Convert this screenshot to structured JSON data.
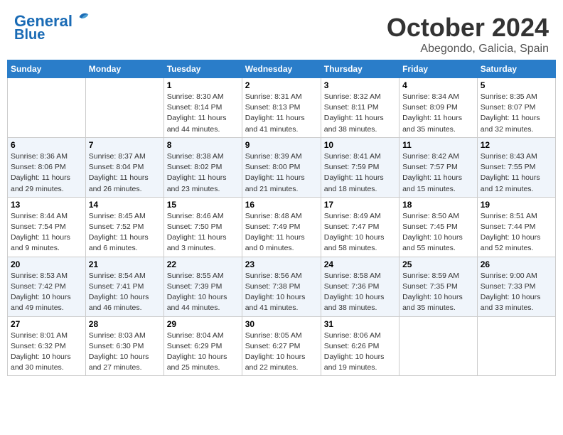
{
  "header": {
    "logo_line1": "General",
    "logo_line2": "Blue",
    "month_title": "October 2024",
    "location": "Abegondo, Galicia, Spain"
  },
  "days_of_week": [
    "Sunday",
    "Monday",
    "Tuesday",
    "Wednesday",
    "Thursday",
    "Friday",
    "Saturday"
  ],
  "weeks": [
    [
      {
        "day": "",
        "info": ""
      },
      {
        "day": "",
        "info": ""
      },
      {
        "day": "1",
        "info": "Sunrise: 8:30 AM\nSunset: 8:14 PM\nDaylight: 11 hours and 44 minutes."
      },
      {
        "day": "2",
        "info": "Sunrise: 8:31 AM\nSunset: 8:13 PM\nDaylight: 11 hours and 41 minutes."
      },
      {
        "day": "3",
        "info": "Sunrise: 8:32 AM\nSunset: 8:11 PM\nDaylight: 11 hours and 38 minutes."
      },
      {
        "day": "4",
        "info": "Sunrise: 8:34 AM\nSunset: 8:09 PM\nDaylight: 11 hours and 35 minutes."
      },
      {
        "day": "5",
        "info": "Sunrise: 8:35 AM\nSunset: 8:07 PM\nDaylight: 11 hours and 32 minutes."
      }
    ],
    [
      {
        "day": "6",
        "info": "Sunrise: 8:36 AM\nSunset: 8:06 PM\nDaylight: 11 hours and 29 minutes."
      },
      {
        "day": "7",
        "info": "Sunrise: 8:37 AM\nSunset: 8:04 PM\nDaylight: 11 hours and 26 minutes."
      },
      {
        "day": "8",
        "info": "Sunrise: 8:38 AM\nSunset: 8:02 PM\nDaylight: 11 hours and 23 minutes."
      },
      {
        "day": "9",
        "info": "Sunrise: 8:39 AM\nSunset: 8:00 PM\nDaylight: 11 hours and 21 minutes."
      },
      {
        "day": "10",
        "info": "Sunrise: 8:41 AM\nSunset: 7:59 PM\nDaylight: 11 hours and 18 minutes."
      },
      {
        "day": "11",
        "info": "Sunrise: 8:42 AM\nSunset: 7:57 PM\nDaylight: 11 hours and 15 minutes."
      },
      {
        "day": "12",
        "info": "Sunrise: 8:43 AM\nSunset: 7:55 PM\nDaylight: 11 hours and 12 minutes."
      }
    ],
    [
      {
        "day": "13",
        "info": "Sunrise: 8:44 AM\nSunset: 7:54 PM\nDaylight: 11 hours and 9 minutes."
      },
      {
        "day": "14",
        "info": "Sunrise: 8:45 AM\nSunset: 7:52 PM\nDaylight: 11 hours and 6 minutes."
      },
      {
        "day": "15",
        "info": "Sunrise: 8:46 AM\nSunset: 7:50 PM\nDaylight: 11 hours and 3 minutes."
      },
      {
        "day": "16",
        "info": "Sunrise: 8:48 AM\nSunset: 7:49 PM\nDaylight: 11 hours and 0 minutes."
      },
      {
        "day": "17",
        "info": "Sunrise: 8:49 AM\nSunset: 7:47 PM\nDaylight: 10 hours and 58 minutes."
      },
      {
        "day": "18",
        "info": "Sunrise: 8:50 AM\nSunset: 7:45 PM\nDaylight: 10 hours and 55 minutes."
      },
      {
        "day": "19",
        "info": "Sunrise: 8:51 AM\nSunset: 7:44 PM\nDaylight: 10 hours and 52 minutes."
      }
    ],
    [
      {
        "day": "20",
        "info": "Sunrise: 8:53 AM\nSunset: 7:42 PM\nDaylight: 10 hours and 49 minutes."
      },
      {
        "day": "21",
        "info": "Sunrise: 8:54 AM\nSunset: 7:41 PM\nDaylight: 10 hours and 46 minutes."
      },
      {
        "day": "22",
        "info": "Sunrise: 8:55 AM\nSunset: 7:39 PM\nDaylight: 10 hours and 44 minutes."
      },
      {
        "day": "23",
        "info": "Sunrise: 8:56 AM\nSunset: 7:38 PM\nDaylight: 10 hours and 41 minutes."
      },
      {
        "day": "24",
        "info": "Sunrise: 8:58 AM\nSunset: 7:36 PM\nDaylight: 10 hours and 38 minutes."
      },
      {
        "day": "25",
        "info": "Sunrise: 8:59 AM\nSunset: 7:35 PM\nDaylight: 10 hours and 35 minutes."
      },
      {
        "day": "26",
        "info": "Sunrise: 9:00 AM\nSunset: 7:33 PM\nDaylight: 10 hours and 33 minutes."
      }
    ],
    [
      {
        "day": "27",
        "info": "Sunrise: 8:01 AM\nSunset: 6:32 PM\nDaylight: 10 hours and 30 minutes."
      },
      {
        "day": "28",
        "info": "Sunrise: 8:03 AM\nSunset: 6:30 PM\nDaylight: 10 hours and 27 minutes."
      },
      {
        "day": "29",
        "info": "Sunrise: 8:04 AM\nSunset: 6:29 PM\nDaylight: 10 hours and 25 minutes."
      },
      {
        "day": "30",
        "info": "Sunrise: 8:05 AM\nSunset: 6:27 PM\nDaylight: 10 hours and 22 minutes."
      },
      {
        "day": "31",
        "info": "Sunrise: 8:06 AM\nSunset: 6:26 PM\nDaylight: 10 hours and 19 minutes."
      },
      {
        "day": "",
        "info": ""
      },
      {
        "day": "",
        "info": ""
      }
    ]
  ]
}
